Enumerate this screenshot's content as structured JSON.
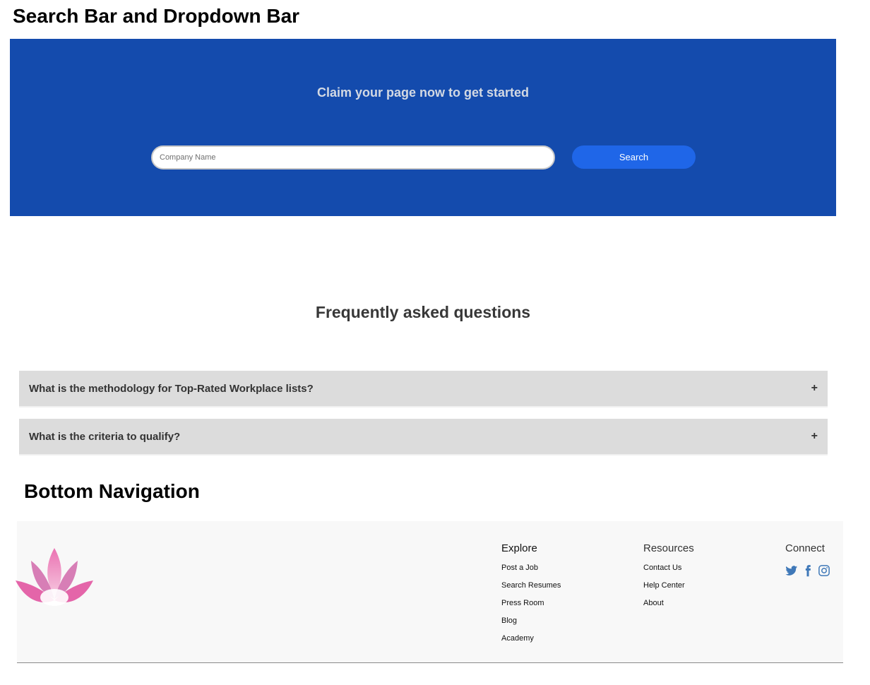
{
  "labels": {
    "search_section": "Search Bar and Dropdown Bar",
    "bottom_section": "Bottom Navigation"
  },
  "hero": {
    "title": "Claim your page now to get started",
    "input_placeholder": "Company Name",
    "input_value": "",
    "search_button": "Search",
    "background_color": "#144bad",
    "button_color": "#1f66e8"
  },
  "faq": {
    "title": "Frequently asked questions",
    "items": [
      {
        "question": "What is the methodology for Top-Rated Workplace lists?",
        "toggle": "+"
      },
      {
        "question": "What is the criteria to qualify?",
        "toggle": "+"
      }
    ]
  },
  "footer": {
    "logo_icon": "lotus-logo-icon",
    "explore": {
      "heading": "Explore",
      "links": [
        "Post a Job",
        "Search Resumes",
        "Press Room",
        "Blog",
        "Academy"
      ]
    },
    "resources": {
      "heading": "Resources",
      "links": [
        "Contact Us",
        "Help Center",
        "About"
      ]
    },
    "connect": {
      "heading": "Connect",
      "icons": [
        "twitter-icon",
        "facebook-icon",
        "instagram-icon"
      ],
      "icon_color": "#3f78b8"
    }
  }
}
